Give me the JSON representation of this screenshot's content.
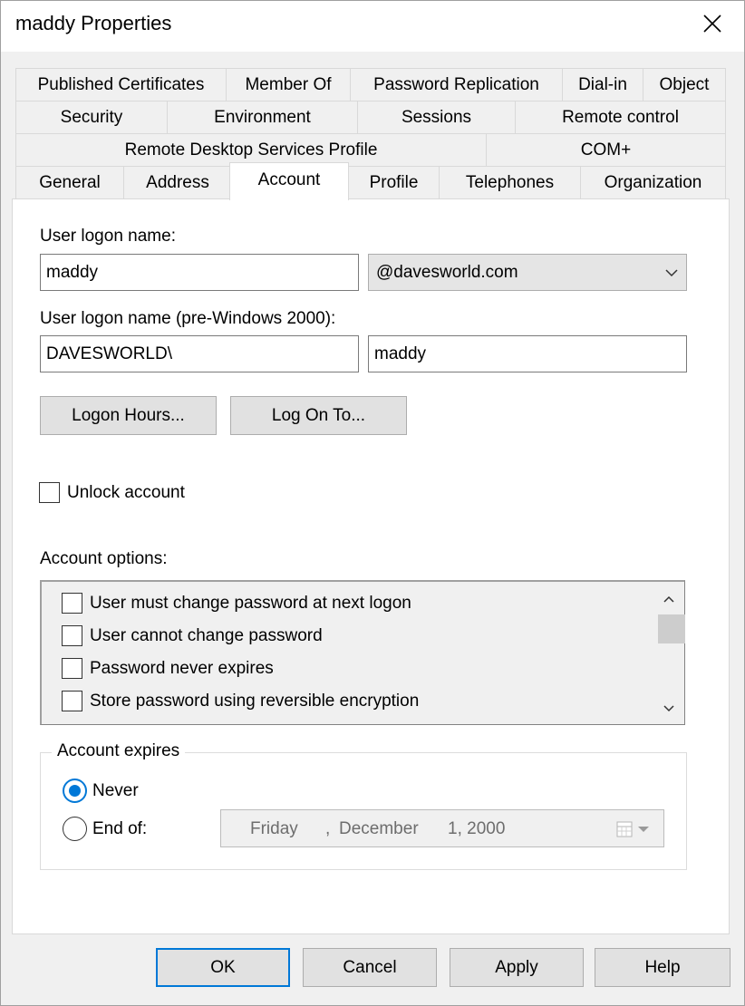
{
  "window": {
    "title": "maddy Properties"
  },
  "tabs": {
    "row1": [
      "Published Certificates",
      "Member Of",
      "Password Replication",
      "Dial-in",
      "Object"
    ],
    "row2": [
      "Security",
      "Environment",
      "Sessions",
      "Remote control"
    ],
    "row3": [
      "Remote Desktop Services Profile",
      "COM+"
    ],
    "row4": [
      "General",
      "Address",
      "Account",
      "Profile",
      "Telephones",
      "Organization"
    ],
    "active": "Account"
  },
  "account": {
    "logon_name_label": "User logon name:",
    "logon_name_value": "maddy",
    "domain_suffix": "@davesworld.com",
    "pre2000_label": "User logon name (pre-Windows 2000):",
    "pre2000_domain": "DAVESWORLD\\",
    "pre2000_user": "maddy",
    "logon_hours_button": "Logon Hours...",
    "log_on_to_button": "Log On To...",
    "unlock_label": "Unlock account",
    "options_label": "Account options:",
    "options": [
      "User must change password at next logon",
      "User cannot change password",
      "Password never expires",
      "Store password using reversible encryption"
    ],
    "expires_title": "Account expires",
    "never_label": "Never",
    "end_of_label": "End of:",
    "date": {
      "weekday": "Friday",
      "sep": ",",
      "month": "December",
      "day_year": "1, 2000"
    }
  },
  "footer": {
    "ok": "OK",
    "cancel": "Cancel",
    "apply": "Apply",
    "help": "Help"
  },
  "colors": {
    "accent": "#0078d7",
    "panel": "#ffffff",
    "chrome": "#f0f0f0"
  }
}
